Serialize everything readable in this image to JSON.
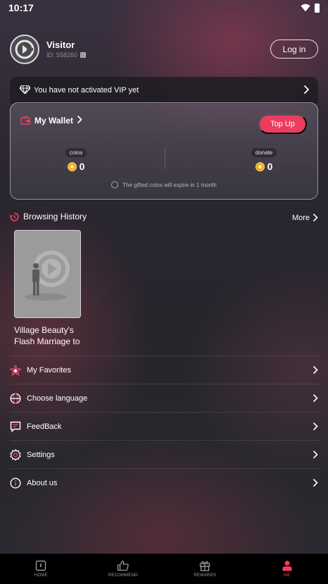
{
  "status_bar": {
    "time": "10:17"
  },
  "profile": {
    "name": "Visitor",
    "id_text": "ID:  558260",
    "login_label": "Log in"
  },
  "vip": {
    "text": "You have not activated VIP yet"
  },
  "wallet": {
    "title": "My Wallet",
    "topup_label": "Top Up",
    "coins_label": "coins",
    "coins_value": "0",
    "donate_label": "donate",
    "donate_value": "0",
    "note": "The gifted coins will expire in 1 month"
  },
  "history": {
    "title": "Browsing History",
    "more_label": "More",
    "items": [
      {
        "title": "Village Beauty's Flash Marriage to"
      }
    ]
  },
  "menu": {
    "items": [
      {
        "label": "My Favorites",
        "icon": "star-icon"
      },
      {
        "label": "Choose language",
        "icon": "globe-icon"
      },
      {
        "label": "FeedBack",
        "icon": "feedback-icon"
      },
      {
        "label": "Settings",
        "icon": "gear-icon"
      },
      {
        "label": "About us",
        "icon": "info-icon"
      }
    ]
  },
  "bottom_nav": {
    "items": [
      {
        "label": "HOME",
        "icon": "home-icon"
      },
      {
        "label": "RECOMMEND",
        "icon": "thumbs-up-icon"
      },
      {
        "label": "REWARDS",
        "icon": "gift-icon"
      },
      {
        "label": "ME",
        "icon": "person-icon",
        "active": true
      }
    ]
  },
  "colors": {
    "accent": "#ec3d5f",
    "coin": "#f3a91d"
  }
}
